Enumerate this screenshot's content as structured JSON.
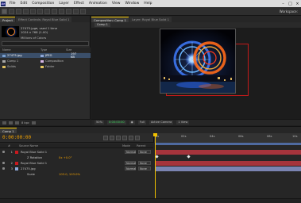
{
  "menubar": {
    "app_icon": "Ae",
    "items": [
      "File",
      "Edit",
      "Composition",
      "Layer",
      "Effect",
      "Animation",
      "View",
      "Window",
      "Help"
    ],
    "win_buttons": [
      "–",
      "□",
      "×"
    ]
  },
  "toolbar": {
    "tool_count": 12,
    "workspace_label": "Workspace:"
  },
  "project": {
    "tabs": [
      "Project",
      "Effect Controls: Royal Blue Solid 1"
    ],
    "preview_asset": {
      "name": "27475.jpg",
      "used": "▾, used 1 time",
      "dimensions": "1024 x 768 (1.00)",
      "colors": "Millions of Colors"
    },
    "columns": [
      "Name",
      "Type",
      "Size"
    ],
    "items": [
      {
        "name": "27475.jpg",
        "type": "JPEG",
        "size": "197 KB",
        "label_color": "#8fa8d8",
        "icon_color": "#7aa0d0",
        "selected": true
      },
      {
        "name": "Comp 1",
        "type": "Composition",
        "size": "",
        "label_color": "#d8b8e8",
        "icon_color": "#a7a7a7",
        "selected": false
      },
      {
        "name": "Solids",
        "type": "Folder",
        "size": "",
        "label_color": "#e8c860",
        "icon_color": "#e0c060",
        "selected": false
      }
    ],
    "bit_depth": "8 bpc"
  },
  "composition": {
    "tabs": [
      "Composition: Comp 1",
      "Layer: Royal Blue Solid 1"
    ],
    "sub_tab": "Comp 1",
    "footer": {
      "zoom": "50%",
      "timecode": "0:00:00:00",
      "resolution": "Full",
      "view": "Active Camera",
      "views_count": "1 View"
    }
  },
  "timeline": {
    "tab": "Comp 1",
    "timecode": "0:00:00:00",
    "ruler_ticks": [
      "0s",
      "02s",
      "04s",
      "06s",
      "08s",
      "10s"
    ],
    "layer_header": [
      "#",
      "Source Name",
      "Mode",
      "T TrkMat",
      "Parent"
    ],
    "layers": [
      {
        "num": "1",
        "name": "Royal Blue Solid 1",
        "label": "#c9191e",
        "mode": "Normal",
        "parent": "None",
        "bar": "#a5343c",
        "value": "",
        "kind": "layer"
      },
      {
        "num": "",
        "name": "Z Rotation",
        "label": "",
        "mode": "",
        "parent": "",
        "bar": "",
        "value": "0x +0.0°",
        "kind": "prop"
      },
      {
        "num": "2",
        "name": "Royal Blue Solid 1",
        "label": "#c9191e",
        "mode": "Normal",
        "parent": "None",
        "bar": "#a5343c",
        "value": "",
        "kind": "layer"
      },
      {
        "num": "3",
        "name": "27475.jpg",
        "label": "#8fa8d8",
        "mode": "Normal",
        "parent": "None",
        "bar": "#7a84b2",
        "value": "",
        "kind": "layer"
      },
      {
        "num": "",
        "name": "Scale",
        "label": "",
        "mode": "",
        "parent": "",
        "bar": "",
        "value": "103.0, 103.0%",
        "kind": "prop"
      }
    ]
  },
  "colors": {
    "accent_timecode": "#f0a000",
    "comp_bounds": "#c41a1a",
    "playhead": "#f0c000"
  }
}
